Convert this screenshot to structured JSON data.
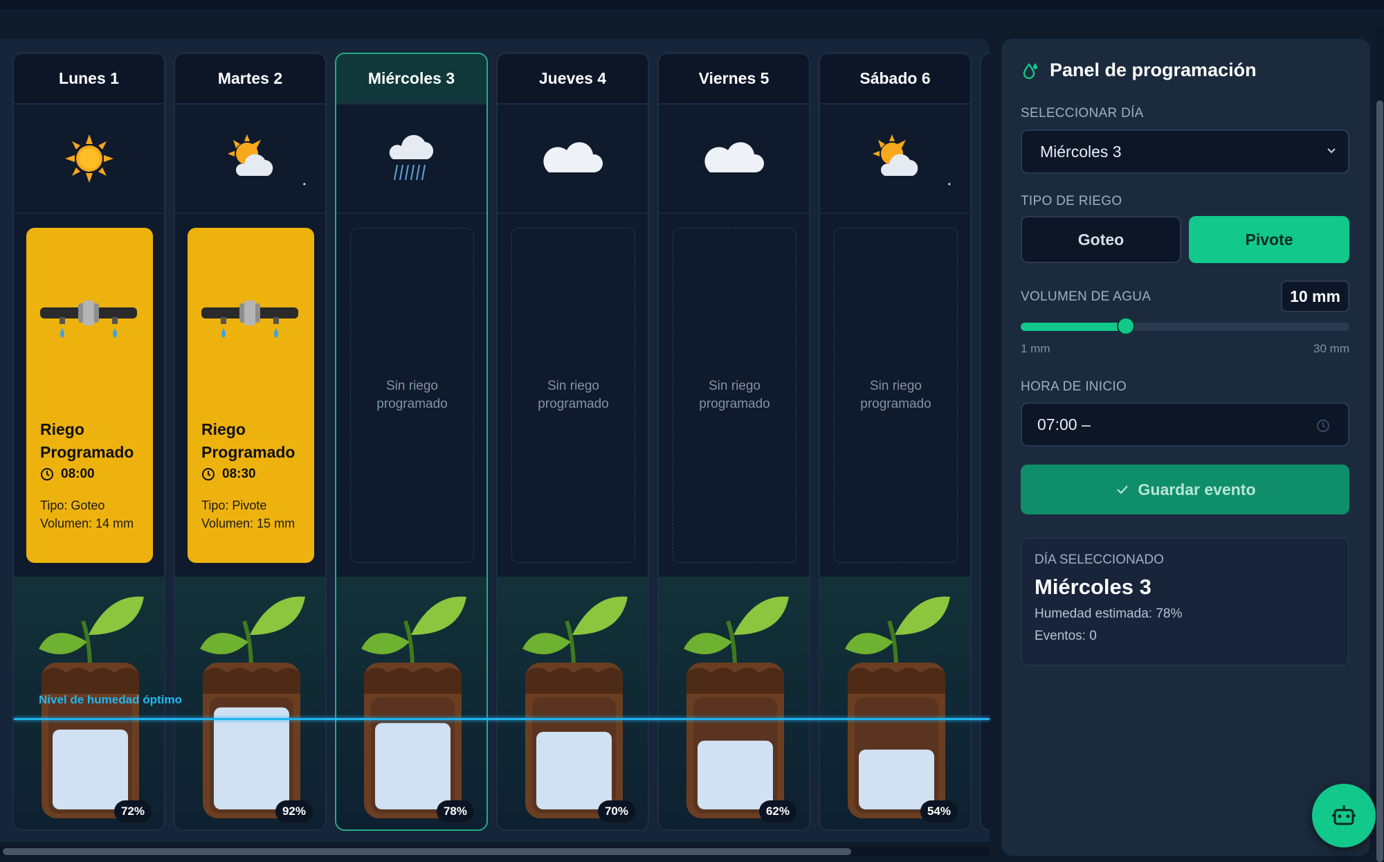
{
  "days": [
    {
      "name": "Lunes 1",
      "weather": "sun-icon",
      "event": {
        "title": "Riego Programado",
        "time": "08:00",
        "type": "Tipo: Goteo",
        "volume": "Volumen: 14 mm"
      },
      "humidity": "72%",
      "humidity_value": 72
    },
    {
      "name": "Martes 2",
      "weather": "partly-cloudy-icon",
      "event": {
        "title": "Riego Programado",
        "time": "08:30",
        "type": "Tipo: Pivote",
        "volume": "Volumen: 15 mm"
      },
      "humidity": "92%",
      "humidity_value": 92
    },
    {
      "name": "Miércoles 3",
      "weather": "rain-cloud-icon",
      "empty": "Sin riego programado",
      "humidity": "78%",
      "humidity_value": 78
    },
    {
      "name": "Jueves 4",
      "weather": "cloud-icon",
      "empty": "Sin riego programado",
      "humidity": "70%",
      "humidity_value": 70
    },
    {
      "name": "Viernes 5",
      "weather": "cloud-icon",
      "empty": "Sin riego programado",
      "humidity": "62%",
      "humidity_value": 62
    },
    {
      "name": "Sábado 6",
      "weather": "partly-cloudy-icon",
      "empty": "Sin riego programado",
      "humidity": "54%",
      "humidity_value": 54
    }
  ],
  "optimal_label": "Nivel de humedad óptimo",
  "panel": {
    "title": "Panel de programación",
    "select_day_label": "SELECCIONAR DÍA",
    "selected_day": "Miércoles 3",
    "irrigation_type_label": "TIPO DE RIEGO",
    "type_options": [
      "Goteo",
      "Pivote"
    ],
    "active_type": "Pivote",
    "volume_label": "VOLUMEN DE AGUA",
    "volume_value": "10 mm",
    "volume_min": "1 mm",
    "volume_max": "30 mm",
    "volume_fraction": 0.32,
    "start_time_label": "HORA DE INICIO",
    "start_time": "07:00 –",
    "save_label": "Guardar evento",
    "info": {
      "label": "DÍA SELECCIONADO",
      "day": "Miércoles 3",
      "humidity": "Humedad estimada: 78%",
      "events": "Eventos: 0"
    }
  },
  "colors": {
    "accent": "#12c88a",
    "event": "#eeb20f",
    "optimal": "#1fb3f0"
  }
}
